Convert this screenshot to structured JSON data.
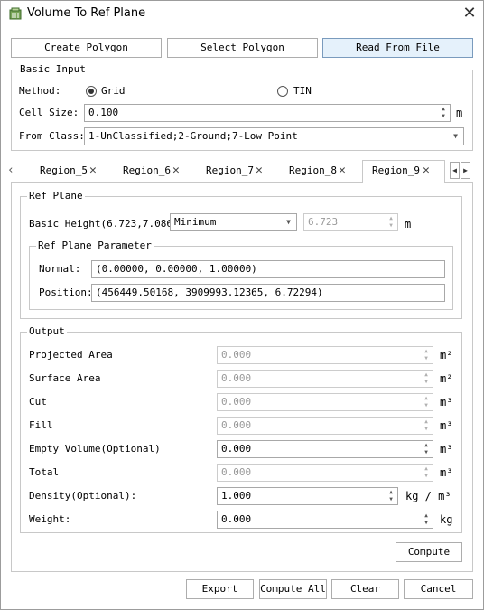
{
  "window": {
    "title": "Volume To Ref Plane",
    "app_icon": "app-icon",
    "close_icon": "close-icon"
  },
  "toolbar": {
    "create_polygon": "Create Polygon",
    "select_polygon": "Select Polygon",
    "read_from_file": "Read From File"
  },
  "basic_input": {
    "title": "Basic Input",
    "method_label": "Method:",
    "method_options": [
      "Grid",
      "TIN"
    ],
    "method_selected": "Grid",
    "cell_size_label": "Cell Size:",
    "cell_size_value": "0.100",
    "cell_size_unit": "m",
    "from_class_label": "From Class:",
    "from_class_value": "1-UnClassified;2-Ground;7-Low Point"
  },
  "tabs": {
    "items": [
      "Region_5",
      "Region_6",
      "Region_7",
      "Region_8",
      "Region_9"
    ],
    "selected": "Region_9",
    "close_icon": "close-icon",
    "scroll_icons": [
      "chevron-left-icon",
      "chevron-right-icon"
    ]
  },
  "ref_plane": {
    "title": "Ref Plane",
    "basic_height_label": "Basic Height(6.723,7.086)",
    "basic_height_mode": "Minimum",
    "basic_height_value": "6.723",
    "basic_height_unit": "m",
    "parameter": {
      "title": "Ref Plane Parameter",
      "normal_label": "Normal:",
      "normal_value": "(0.00000, 0.00000, 1.00000)",
      "position_label": "Position:",
      "position_value": "(456449.50168, 3909993.12365, 6.72294)"
    }
  },
  "output": {
    "title": "Output",
    "rows": [
      {
        "label": "Projected Area",
        "value": "0.000",
        "unit": "m²",
        "enabled": false
      },
      {
        "label": "Surface Area",
        "value": "0.000",
        "unit": "m²",
        "enabled": false
      },
      {
        "label": "Cut",
        "value": "0.000",
        "unit": "m³",
        "enabled": false
      },
      {
        "label": "Fill",
        "value": "0.000",
        "unit": "m³",
        "enabled": false
      },
      {
        "label": "Empty Volume(Optional)",
        "value": "0.000",
        "unit": "m³",
        "enabled": true
      },
      {
        "label": "Total",
        "value": "0.000",
        "unit": "m³",
        "enabled": false
      },
      {
        "label": "Density(Optional):",
        "value": "1.000",
        "unit": "kg / m³",
        "enabled": true
      },
      {
        "label": "Weight:",
        "value": "0.000",
        "unit": "kg",
        "enabled": true
      }
    ]
  },
  "compute_button": "Compute",
  "footer": {
    "export": "Export",
    "compute_all": "Compute All",
    "clear": "Clear",
    "cancel": "Cancel"
  },
  "colors": {
    "active_button_bg": "#e5f1fb",
    "border": "#c8c8c8",
    "disabled_text": "#9a9a9a"
  }
}
